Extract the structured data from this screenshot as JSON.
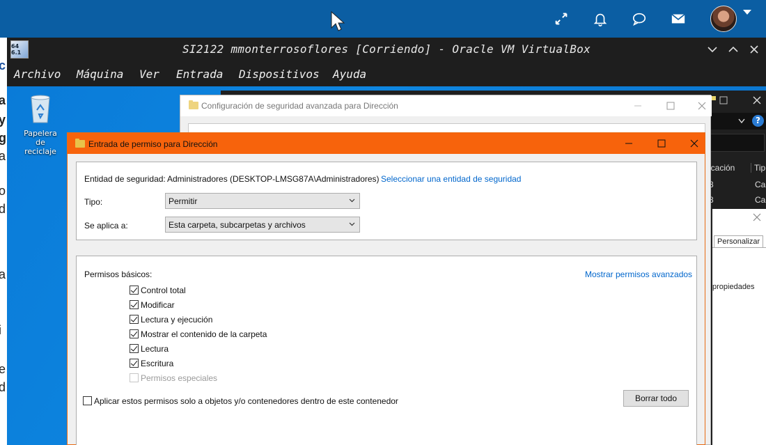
{
  "host": {
    "icons": [
      "expand-icon",
      "bell-icon",
      "chat-icon",
      "mail-icon"
    ]
  },
  "vbox": {
    "title": "SI2122 mmonterrosoflores [Corriendo] - Oracle VM VirtualBox",
    "logo_text": "64 6.1",
    "menu": [
      "Archivo",
      "Máquina",
      "Ver",
      "Entrada",
      "Dispositivos",
      "Ayuda"
    ]
  },
  "desktop": {
    "recycle_label": "Papelera de reciclaje"
  },
  "background": {
    "col_header": "icación",
    "col_header2": "Tip",
    "row1a": "8",
    "row1b": "Ca",
    "row2a": "8",
    "row2b": "Ca",
    "tab": "Personalizar",
    "side_text": "propiedades"
  },
  "config_window": {
    "title": "Configuración de seguridad avanzada para Dirección"
  },
  "perm_window": {
    "title": "Entrada de permiso para Dirección",
    "principal_label": "Entidad de seguridad:",
    "principal_value": "Administradores (DESKTOP-LMSG87A\\Administradores)",
    "select_principal_link": "Seleccionar una entidad de seguridad",
    "type_label": "Tipo:",
    "type_value": "Permitir",
    "applies_label": "Se aplica a:",
    "applies_value": "Esta carpeta, subcarpetas y archivos",
    "basic_label": "Permisos básicos:",
    "advanced_link": "Mostrar permisos avanzados",
    "permissions": [
      {
        "label": "Control total",
        "checked": true,
        "disabled": false
      },
      {
        "label": "Modificar",
        "checked": true,
        "disabled": false
      },
      {
        "label": "Lectura y ejecución",
        "checked": true,
        "disabled": false
      },
      {
        "label": "Mostrar el contenido de la carpeta",
        "checked": true,
        "disabled": false
      },
      {
        "label": "Lectura",
        "checked": true,
        "disabled": false
      },
      {
        "label": "Escritura",
        "checked": true,
        "disabled": false
      },
      {
        "label": "Permisos especiales",
        "checked": false,
        "disabled": true
      }
    ],
    "apply_only_label": "Aplicar estos permisos solo a objetos y/o contenedores dentro de este contenedor",
    "clear_all_button": "Borrar todo"
  },
  "colors": {
    "accent_orange": "#f7630c",
    "link_blue": "#0066cc",
    "host_blue": "#0b5ea3"
  }
}
